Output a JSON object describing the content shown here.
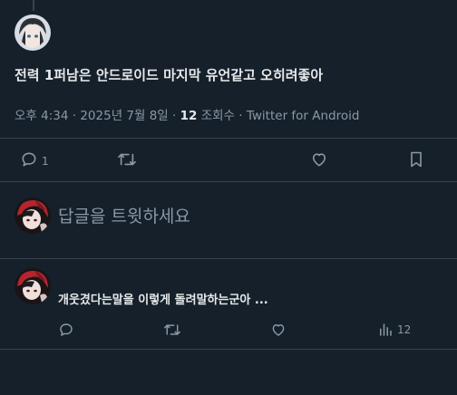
{
  "tweet": {
    "text": "전력 1퍼남은 안드로이드 마지막 유언같고 오히려좋아",
    "time": "오후 4:34",
    "date": "2025년 7월 8일",
    "views_count": "12",
    "views_label": "조회수",
    "source": "Twitter for Android",
    "actions": {
      "reply_count": "1"
    }
  },
  "compose": {
    "placeholder": "답글을 트윗하세요"
  },
  "reply": {
    "text": "개웃겼다는말을 이렇게 돌려말하는군아 ...",
    "analytics_count": "12"
  },
  "icons": {
    "reply": "reply-icon",
    "retweet": "retweet-icon",
    "like": "heart-icon",
    "bookmark": "bookmark-icon",
    "analytics": "analytics-icon"
  },
  "colors": {
    "background": "#15202b",
    "text": "#e7e9ea",
    "secondary": "#8b98a5",
    "divider": "#38444d"
  }
}
